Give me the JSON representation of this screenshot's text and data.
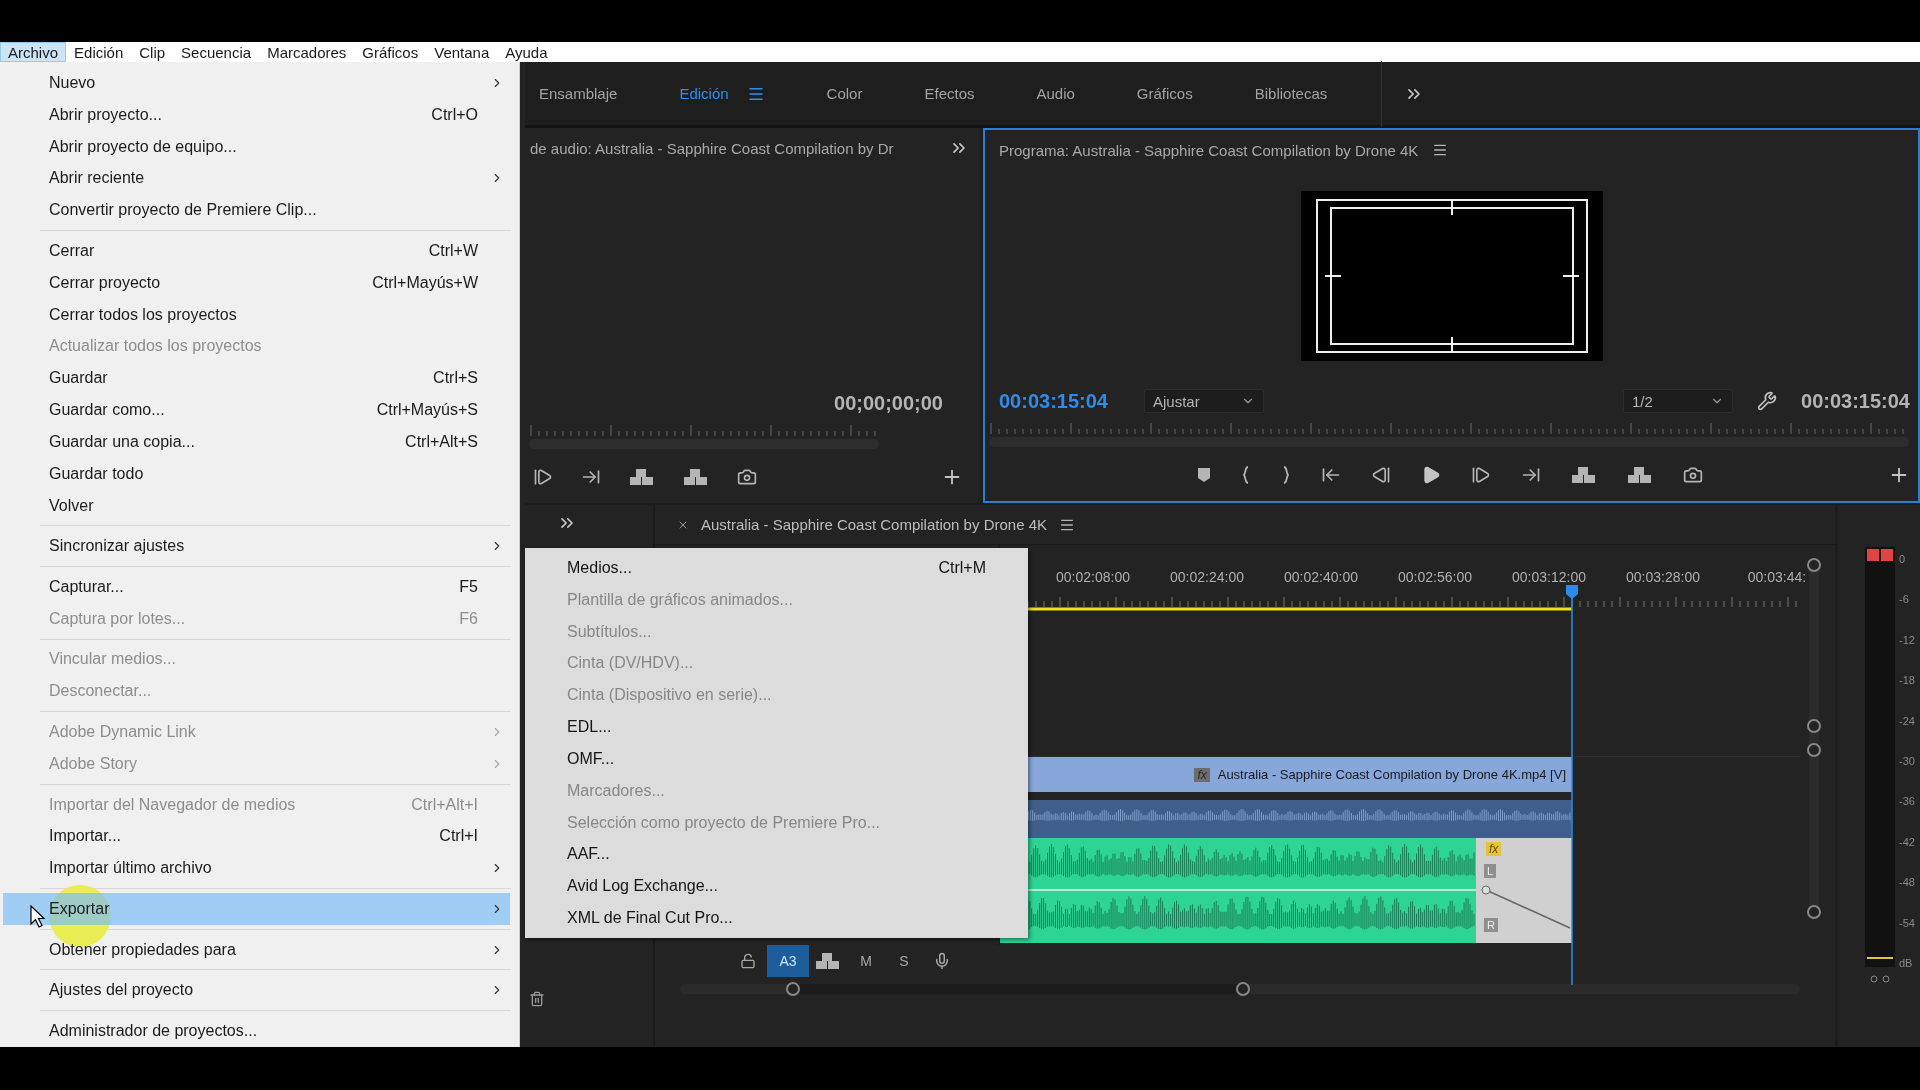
{
  "menubar": [
    {
      "label": "Archivo",
      "selected": true
    },
    {
      "label": "Edición",
      "selected": false
    },
    {
      "label": "Clip",
      "selected": false
    },
    {
      "label": "Secuencia",
      "selected": false
    },
    {
      "label": "Marcadores",
      "selected": false
    },
    {
      "label": "Gráficos",
      "selected": false
    },
    {
      "label": "Ventana",
      "selected": false
    },
    {
      "label": "Ayuda",
      "selected": false
    }
  ],
  "file_menu": {
    "groups": [
      {
        "items": [
          {
            "label": "Nuevo",
            "submenu": true,
            "disabled": false,
            "selected": false
          },
          {
            "label": "Abrir proyecto...",
            "shortcut": "Ctrl+O",
            "submenu": false,
            "disabled": false,
            "selected": false
          },
          {
            "label": "Abrir proyecto de equipo...",
            "submenu": false,
            "disabled": false,
            "selected": false
          },
          {
            "label": "Abrir reciente",
            "submenu": true,
            "disabled": false,
            "selected": false
          },
          {
            "label": "Convertir proyecto de Premiere Clip...",
            "submenu": false,
            "disabled": false,
            "selected": false
          }
        ]
      },
      {
        "items": [
          {
            "label": "Cerrar",
            "shortcut": "Ctrl+W",
            "submenu": false,
            "disabled": false,
            "selected": false
          },
          {
            "label": "Cerrar proyecto",
            "shortcut": "Ctrl+Mayús+W",
            "submenu": false,
            "disabled": false,
            "selected": false
          },
          {
            "label": "Cerrar todos los proyectos",
            "submenu": false,
            "disabled": false,
            "selected": false
          },
          {
            "label": "Actualizar todos los proyectos",
            "submenu": false,
            "disabled": true,
            "selected": false
          },
          {
            "label": "Guardar",
            "shortcut": "Ctrl+S",
            "submenu": false,
            "disabled": false,
            "selected": false
          },
          {
            "label": "Guardar como...",
            "shortcut": "Ctrl+Mayús+S",
            "submenu": false,
            "disabled": false,
            "selected": false
          },
          {
            "label": "Guardar una copia...",
            "shortcut": "Ctrl+Alt+S",
            "submenu": false,
            "disabled": false,
            "selected": false
          },
          {
            "label": "Guardar todo",
            "submenu": false,
            "disabled": false,
            "selected": false
          },
          {
            "label": "Volver",
            "submenu": false,
            "disabled": false,
            "selected": false
          }
        ]
      },
      {
        "items": [
          {
            "label": "Sincronizar ajustes",
            "submenu": true,
            "disabled": false,
            "selected": false
          }
        ]
      },
      {
        "items": [
          {
            "label": "Capturar...",
            "shortcut": "F5",
            "submenu": false,
            "disabled": false,
            "selected": false
          },
          {
            "label": "Captura por lotes...",
            "shortcut": "F6",
            "submenu": false,
            "disabled": true,
            "selected": false
          }
        ]
      },
      {
        "items": [
          {
            "label": "Vincular medios...",
            "submenu": false,
            "disabled": true,
            "selected": false
          },
          {
            "label": "Desconectar...",
            "submenu": false,
            "disabled": true,
            "selected": false
          }
        ]
      },
      {
        "items": [
          {
            "label": "Adobe Dynamic Link",
            "submenu": true,
            "disabled": true,
            "selected": false
          },
          {
            "label": "Adobe Story",
            "submenu": true,
            "disabled": true,
            "selected": false
          }
        ]
      },
      {
        "items": [
          {
            "label": "Importar del Navegador de medios",
            "shortcut": "Ctrl+Alt+I",
            "submenu": false,
            "disabled": true,
            "selected": false
          },
          {
            "label": "Importar...",
            "shortcut": "Ctrl+I",
            "submenu": false,
            "disabled": false,
            "selected": false
          },
          {
            "label": "Importar último archivo",
            "submenu": true,
            "disabled": false,
            "selected": false
          }
        ]
      },
      {
        "items": [
          {
            "label": "Exportar",
            "submenu": true,
            "disabled": false,
            "selected": true
          }
        ]
      },
      {
        "items": [
          {
            "label": "Obtener propiedades para",
            "submenu": true,
            "disabled": false,
            "selected": false
          }
        ]
      },
      {
        "items": [
          {
            "label": "Ajustes del proyecto",
            "submenu": true,
            "disabled": false,
            "selected": false
          }
        ]
      },
      {
        "items": [
          {
            "label": "Administrador de proyectos...",
            "submenu": false,
            "disabled": false,
            "selected": false
          }
        ]
      }
    ]
  },
  "export_submenu": {
    "items": [
      {
        "label": "Medios...",
        "shortcut": "Ctrl+M",
        "disabled": false
      },
      {
        "label": "Plantilla de gráficos animados...",
        "disabled": true
      },
      {
        "label": "Subtítulos...",
        "disabled": true
      },
      {
        "label": "Cinta (DV/HDV)...",
        "disabled": true
      },
      {
        "label": "Cinta (Dispositivo en serie)...",
        "disabled": true
      },
      {
        "label": "EDL...",
        "disabled": false
      },
      {
        "label": "OMF...",
        "disabled": false
      },
      {
        "label": "Marcadores...",
        "disabled": true
      },
      {
        "label": "Selección como proyecto de Premiere Pro...",
        "disabled": true
      },
      {
        "label": "AAF...",
        "disabled": false
      },
      {
        "label": "Avid Log Exchange...",
        "disabled": false
      },
      {
        "label": "XML de Final Cut Pro...",
        "disabled": false
      }
    ]
  },
  "workspaces": {
    "tabs": [
      {
        "label": "Ensamblaje",
        "selected": false
      },
      {
        "label": "Edición",
        "selected": true
      },
      {
        "label": "Color",
        "selected": false
      },
      {
        "label": "Efectos",
        "selected": false
      },
      {
        "label": "Audio",
        "selected": false
      },
      {
        "label": "Gráficos",
        "selected": false
      },
      {
        "label": "Bibliotecas",
        "selected": false
      }
    ]
  },
  "source_monitor": {
    "title": "de audio: Australia - Sapphire Coast Compilation by Dr",
    "timecode": "00;00;00;00"
  },
  "program_monitor": {
    "title": "Programa: Australia - Sapphire Coast Compilation by Drone 4K",
    "timecode": "00:03:15:04",
    "zoom": "Ajustar",
    "resolution": "1/2",
    "duration": "00:03:15:04"
  },
  "timeline": {
    "title": "Australia - Sapphire Coast Compilation by Drone 4K",
    "ruler": [
      "00:02:08:00",
      "00:02:24:00",
      "00:02:40:00",
      "00:02:56:00",
      "00:03:12:00",
      "00:03:28:00",
      "00:03:44:"
    ],
    "video_clip": {
      "label": "Australia - Sapphire Coast Compilation by Drone 4K.mp4 [V]",
      "effect_badge": "fx"
    },
    "audio_transition": {
      "effect_badge": "fx",
      "channels": [
        "L",
        "R"
      ]
    },
    "track_header": {
      "target": {
        "label": "A3",
        "selected": true
      },
      "mute": "M",
      "solo": "S"
    }
  },
  "audio_meter": {
    "scale": [
      "0",
      "-6",
      "-12",
      "-18",
      "-24",
      "-30",
      "-36",
      "-42",
      "-48",
      "-54",
      "dB"
    ]
  }
}
